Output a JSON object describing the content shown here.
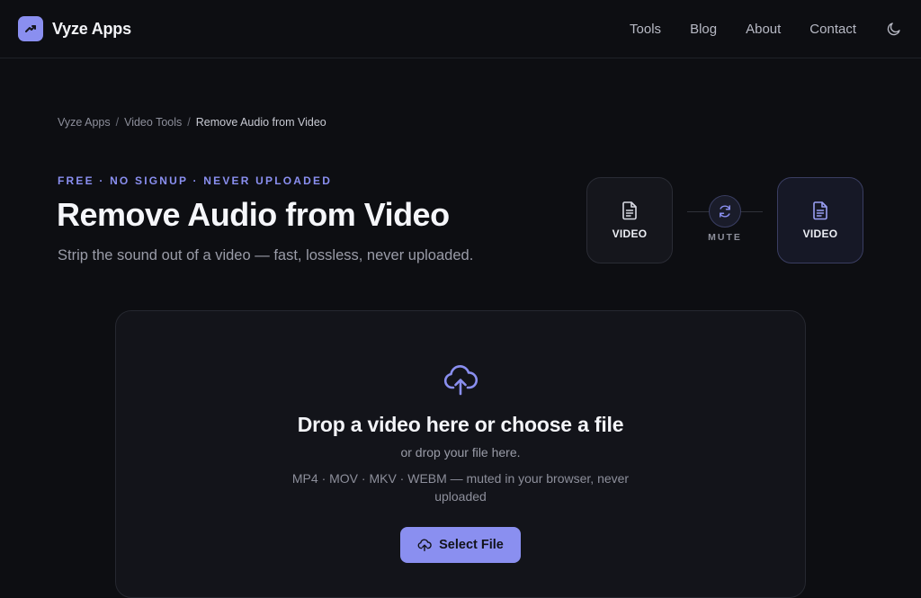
{
  "brand": {
    "name": "Vyze Apps",
    "logo_icon": "trend-arrow-icon",
    "accent": "#8a8ff0"
  },
  "nav": {
    "items": [
      "Tools",
      "Blog",
      "About",
      "Contact"
    ],
    "theme_toggle_icon": "moon-icon"
  },
  "breadcrumb": {
    "items": [
      "Vyze Apps",
      "Video Tools",
      "Remove Audio from Video"
    ],
    "separator": "/"
  },
  "hero": {
    "eyebrow": "FREE · NO SIGNUP · NEVER UPLOADED",
    "title": "Remove Audio from Video",
    "subtitle": "Strip the sound out of a video — fast, lossless, never uploaded."
  },
  "conversion": {
    "from_label": "VIDEO",
    "to_label": "VIDEO",
    "operation": "MUTE",
    "file_icon": "document-icon",
    "operation_icon": "refresh-icon"
  },
  "dropzone": {
    "icon": "cloud-upload-icon",
    "title": "Drop a video here or choose a file",
    "hint": "or drop your file here.",
    "formats": "MP4 · MOV · MKV · WEBM — muted in your browser, never uploaded",
    "button_label": "Select File"
  }
}
